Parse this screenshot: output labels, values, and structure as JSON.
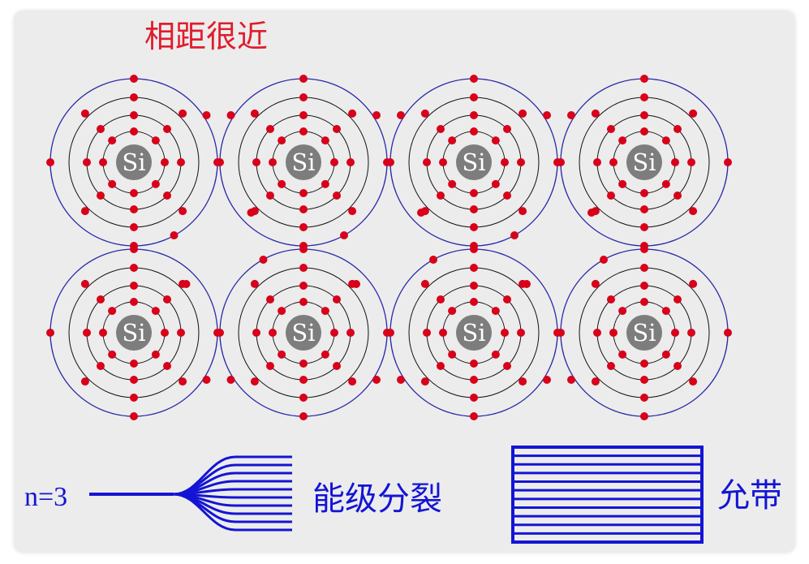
{
  "title": "相距很近",
  "atom_symbol": "Si",
  "atoms_rows": 2,
  "atoms_cols": 4,
  "level_label": "n=3",
  "split_label": "能级分裂",
  "band_label": "允带",
  "colors": {
    "title": "#e01c2c",
    "electron": "#d8001a",
    "orbit": "#111111",
    "boundary": "#2a2aa8",
    "nucleus": "#7d7d7d",
    "energy": "#1414d4",
    "panel": "#ececec"
  }
}
